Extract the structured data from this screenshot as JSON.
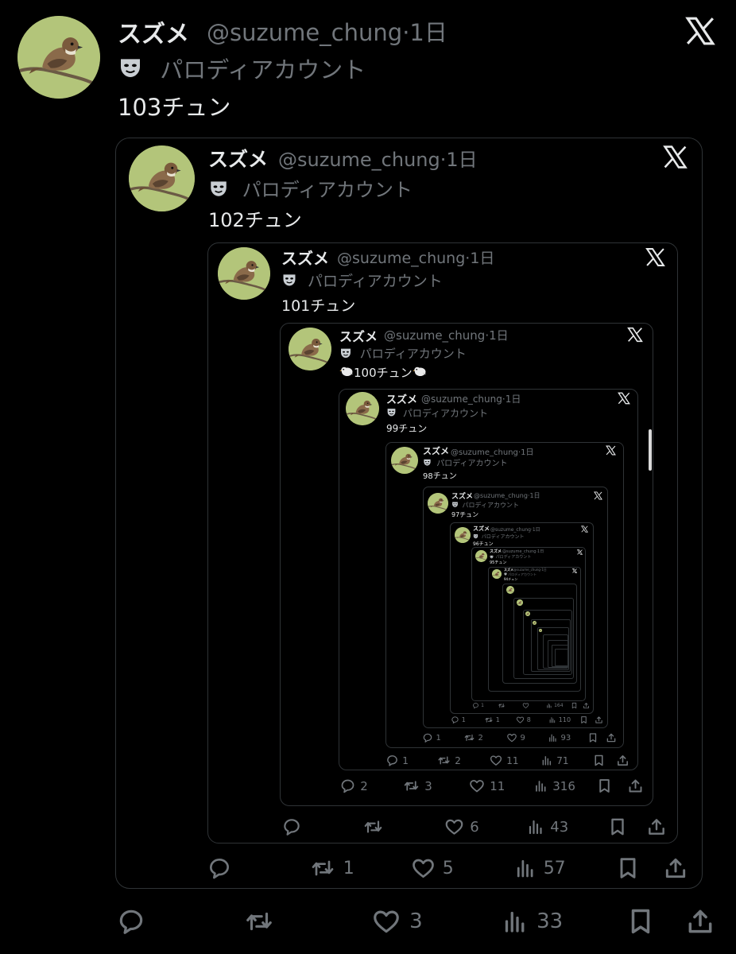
{
  "post": {
    "display_name": "スズメ",
    "handle": "@suzume_chung",
    "time": "1日",
    "badge_label": "パロディアカウント",
    "text": "103チュン",
    "actions": {
      "replies": "",
      "reposts": "",
      "likes": "3",
      "views": "33"
    }
  },
  "quote1": {
    "display_name": "スズメ",
    "handle": "@suzume_chung",
    "time": "1日",
    "badge_label": "パロディアカウント",
    "text": "102チュン",
    "actions": {
      "replies": "",
      "reposts": "1",
      "likes": "5",
      "views": "57"
    }
  },
  "quote2": {
    "display_name": "スズメ",
    "handle": "@suzume_chung",
    "time": "1日",
    "badge_label": "パロディアカウント",
    "text": "101チュン",
    "actions": {
      "replies": "",
      "reposts": "",
      "likes": "6",
      "views": "43"
    }
  },
  "quote3": {
    "display_name": "スズメ",
    "handle": "@suzume_chung",
    "time": "1日",
    "badge_label": "パロディアカウント",
    "text": "100チュン",
    "actions": {
      "replies": "2",
      "reposts": "3",
      "likes": "11",
      "views": "316"
    }
  },
  "quote4": {
    "display_name": "スズメ",
    "handle": "@suzume_chung",
    "time": "1日",
    "badge_label": "パロディアカウント",
    "text": "99チュン",
    "actions": {
      "replies": "1",
      "reposts": "2",
      "likes": "11",
      "views": "71"
    }
  },
  "quote5": {
    "display_name": "スズメ",
    "handle": "@suzume_chung",
    "time": "1日",
    "badge_label": "パロディアカウント",
    "text": "98チュン",
    "actions": {
      "replies": "1",
      "reposts": "2",
      "likes": "9",
      "views": "93"
    }
  },
  "quote6": {
    "display_name": "スズメ",
    "handle": "@suzume_chung",
    "time": "1日",
    "badge_label": "パロディアカウント",
    "text": "97チュン",
    "actions": {
      "replies": "1",
      "reposts": "1",
      "likes": "8",
      "views": "110"
    }
  },
  "quote7": {
    "display_name": "スズメ",
    "handle": "@suzume_chung",
    "time": "1日",
    "badge_label": "パロディアカウント",
    "text": "96チュン",
    "actions": {
      "replies": "1",
      "reposts": "",
      "likes": "",
      "views": "164"
    }
  },
  "quote8": {
    "display_name": "スズメ",
    "handle": "@suzume_chung",
    "time": "1日",
    "badge_label": "パロディアカウント",
    "text": "95チュン"
  },
  "quote9": {
    "display_name": "スズメ",
    "handle": "@suzume_chung",
    "time": "1日",
    "badge_label": "パロディアカウント",
    "text": "94チュン"
  },
  "icons": {
    "brand_logo": "x-logo-icon",
    "badge": "parody-mask-icon",
    "emoji": "bird-emoji-icon",
    "reply": "reply-icon",
    "repost": "repost-icon",
    "like": "like-icon",
    "views": "views-icon",
    "bookmark": "bookmark-icon",
    "share": "share-icon"
  },
  "colors": {
    "background": "#000000",
    "text": "#e7e9ea",
    "secondary": "#71767b",
    "border": "#2f3336"
  }
}
